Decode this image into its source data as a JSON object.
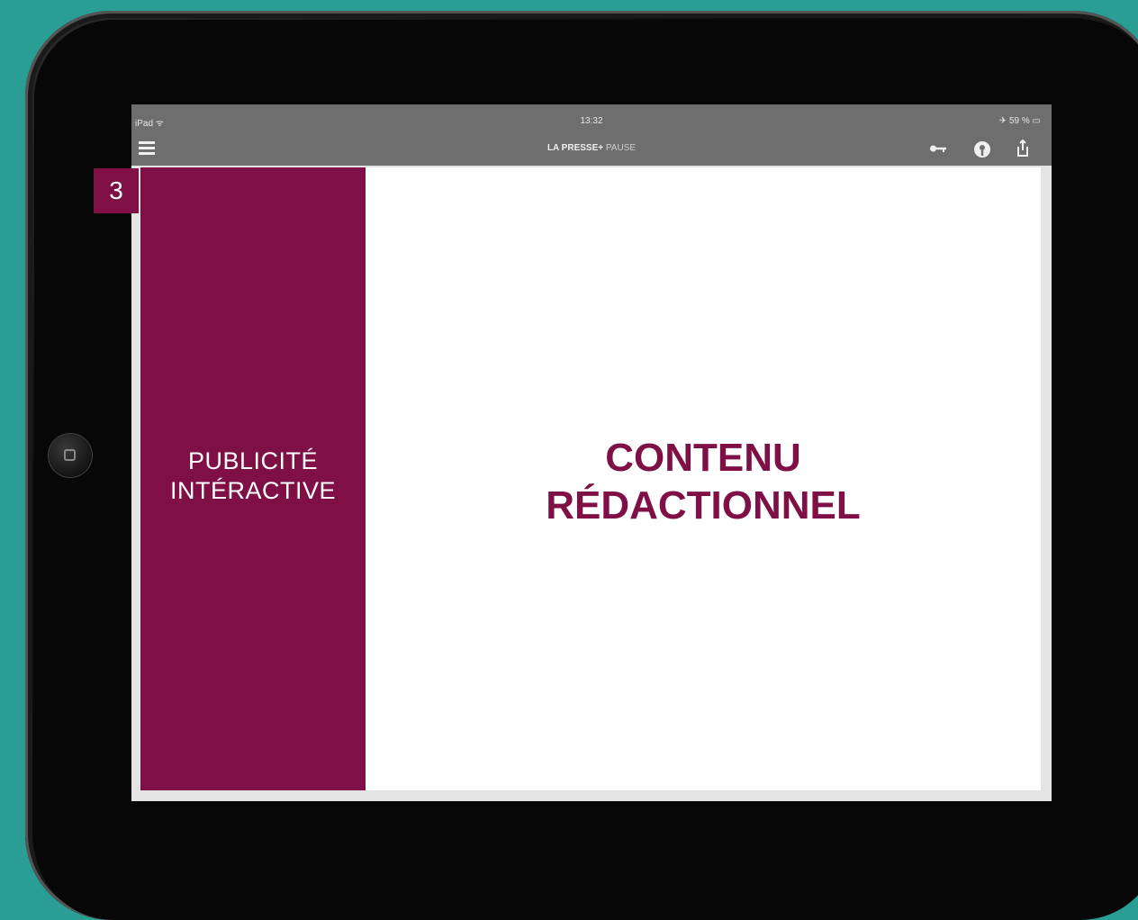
{
  "statusbar": {
    "carrier": "iPad ᯤ",
    "time": "13:32",
    "battery": "✈ 59 % ▭"
  },
  "navbar": {
    "brand": "LA PRESSE+",
    "section": "PAUSE",
    "icons": [
      "menu-icon",
      "key-icon",
      "podcast-icon",
      "share-icon"
    ]
  },
  "page_number": "3",
  "ad_column": {
    "label_line1": "PUBLICITÉ",
    "label_line2": "INTÉRACTIVE",
    "color": "#7f1046"
  },
  "editorial": {
    "line1": "CONTENU",
    "line2": "RÉDACTIONNEL",
    "color": "#7f1046"
  },
  "colors": {
    "background": "#2a9d94",
    "accent": "#7f1046"
  }
}
